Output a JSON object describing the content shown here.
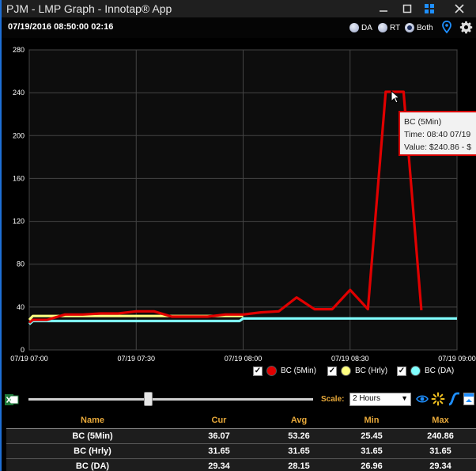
{
  "window": {
    "title": "PJM - LMP Graph - Innotap® App"
  },
  "header": {
    "datetime": "07/19/2016 08:50:00  02:16",
    "radios": [
      {
        "label": "DA",
        "selected": false
      },
      {
        "label": "RT",
        "selected": false
      },
      {
        "label": "Both",
        "selected": true
      }
    ]
  },
  "chart_data": {
    "type": "line",
    "ylim": [
      0,
      280
    ],
    "yticks": [
      0,
      40,
      80,
      120,
      160,
      200,
      240,
      280
    ],
    "xlim": [
      0,
      120
    ],
    "xticks": [
      {
        "x": 0,
        "label": "07/19 07:00"
      },
      {
        "x": 30,
        "label": "07/19 07:30"
      },
      {
        "x": 60,
        "label": "07/19 08:00"
      },
      {
        "x": 90,
        "label": "07/19 08:30"
      },
      {
        "x": 120,
        "label": "07/19 09:00"
      }
    ],
    "series": [
      {
        "name": "BC (5Min)",
        "color": "#e00000",
        "points": [
          [
            0,
            25.45
          ],
          [
            1,
            28
          ],
          [
            5,
            28
          ],
          [
            10,
            33
          ],
          [
            15,
            33
          ],
          [
            20,
            34
          ],
          [
            25,
            34
          ],
          [
            30,
            36
          ],
          [
            35,
            36
          ],
          [
            40,
            31
          ],
          [
            45,
            31
          ],
          [
            50,
            31
          ],
          [
            55,
            33
          ],
          [
            60,
            33
          ],
          [
            65,
            35
          ],
          [
            70,
            36
          ],
          [
            75,
            49
          ],
          [
            80,
            38
          ],
          [
            85,
            38
          ],
          [
            90,
            56
          ],
          [
            95,
            38
          ],
          [
            100,
            240.86
          ],
          [
            105,
            240.86
          ],
          [
            110,
            37
          ]
        ]
      },
      {
        "name": "BC (Hrly)",
        "color": "#ffff80",
        "points": [
          [
            0,
            28
          ],
          [
            1,
            31.65
          ],
          [
            60,
            31.65
          ]
        ]
      },
      {
        "name": "BC (DA)",
        "color": "#80ffff",
        "points": [
          [
            0,
            24
          ],
          [
            1,
            26.96
          ],
          [
            59,
            26.96
          ],
          [
            60,
            29.34
          ],
          [
            120,
            29.34
          ]
        ]
      }
    ]
  },
  "tooltip": {
    "name": "BC (5Min)",
    "time": "Time: 08:40 07/19",
    "value": "Value: $240.86 - $"
  },
  "legend": [
    {
      "label": "BC (5Min)",
      "checked": true,
      "color": "#e00000"
    },
    {
      "label": "BC (Hrly)",
      "checked": true,
      "color": "#ffff80"
    },
    {
      "label": "BC (DA)",
      "checked": true,
      "color": "#80ffff"
    }
  ],
  "toolbar": {
    "scale_label": "Scale:",
    "scale_value": "2 Hours",
    "slider_position": 0.42
  },
  "table": {
    "headers": [
      "Name",
      "Cur",
      "Avg",
      "Min",
      "Max"
    ],
    "rows": [
      [
        "BC (5Min)",
        "36.07",
        "53.26",
        "25.45",
        "240.86"
      ],
      [
        "BC (Hrly)",
        "31.65",
        "31.65",
        "31.65",
        "31.65"
      ],
      [
        "BC (DA)",
        "29.34",
        "28.15",
        "26.96",
        "29.34"
      ]
    ]
  }
}
